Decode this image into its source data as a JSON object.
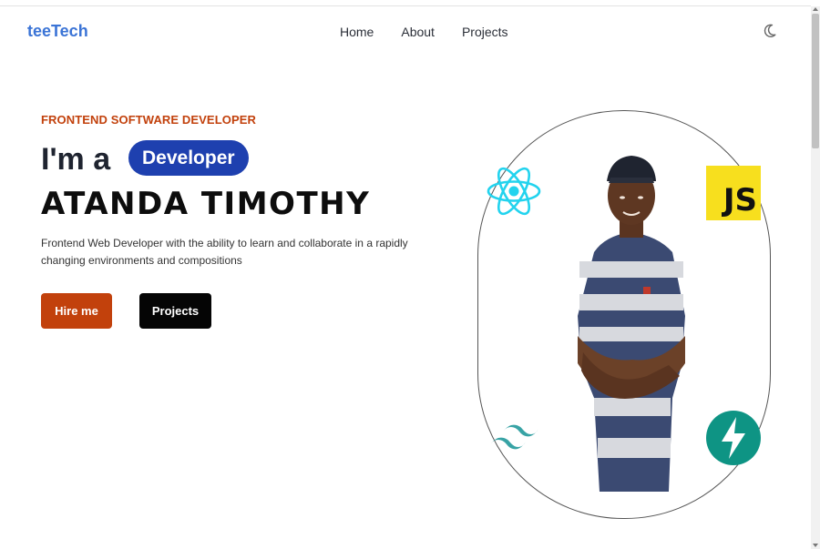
{
  "header": {
    "brand": "teeTech",
    "nav": [
      {
        "label": "Home"
      },
      {
        "label": "About"
      },
      {
        "label": "Projects"
      }
    ],
    "theme_toggle_icon": "moon-icon"
  },
  "hero": {
    "eyebrow": "FRONTEND SOFTWARE DEVELOPER",
    "greeting": "I'm a",
    "role": "Developer",
    "name": "ATANDA TIMOTHY",
    "description": "Frontend Web Developer with the ability to learn and collaborate in a rapidly changing environments and compositions",
    "buttons": {
      "hire": "Hire me",
      "projects": "Projects"
    }
  },
  "showcase": {
    "js_label": "JS",
    "icons": [
      "react-icon",
      "javascript-icon",
      "tailwind-icon",
      "fastapi-icon"
    ]
  },
  "colors": {
    "brand": "#3b74d6",
    "accent": "#c2410c",
    "pill": "#1e40af",
    "dark_button": "#050505"
  }
}
